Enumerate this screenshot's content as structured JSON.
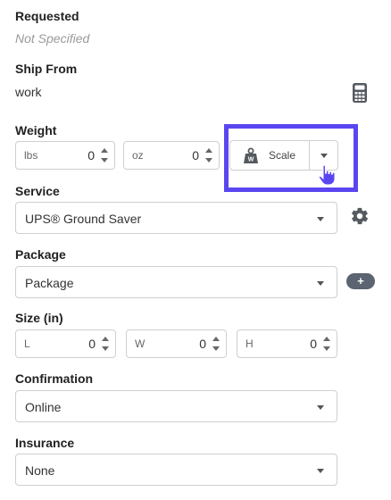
{
  "requested": {
    "label": "Requested",
    "value": "Not Specified"
  },
  "ship_from": {
    "label": "Ship From",
    "value": "work",
    "icon": "calculator-icon"
  },
  "weight": {
    "label": "Weight",
    "lbs": {
      "unit": "lbs",
      "value": "0"
    },
    "oz": {
      "unit": "oz",
      "value": "0"
    },
    "scale_button": {
      "label": "Scale",
      "icon": "scale-weight-icon"
    }
  },
  "service": {
    "label": "Service",
    "selected": "UPS® Ground Saver",
    "icon": "gear-icon"
  },
  "package": {
    "label": "Package",
    "selected": "Package",
    "add_label": "+"
  },
  "size": {
    "label": "Size (in)",
    "length": {
      "unit": "L",
      "value": "0"
    },
    "width": {
      "unit": "W",
      "value": "0"
    },
    "height": {
      "unit": "H",
      "value": "0"
    }
  },
  "confirmation": {
    "label": "Confirmation",
    "selected": "Online"
  },
  "insurance": {
    "label": "Insurance",
    "selected": "None"
  },
  "colors": {
    "highlight": "#5a46f0",
    "pill": "#5b6470",
    "icon": "#555a60"
  }
}
